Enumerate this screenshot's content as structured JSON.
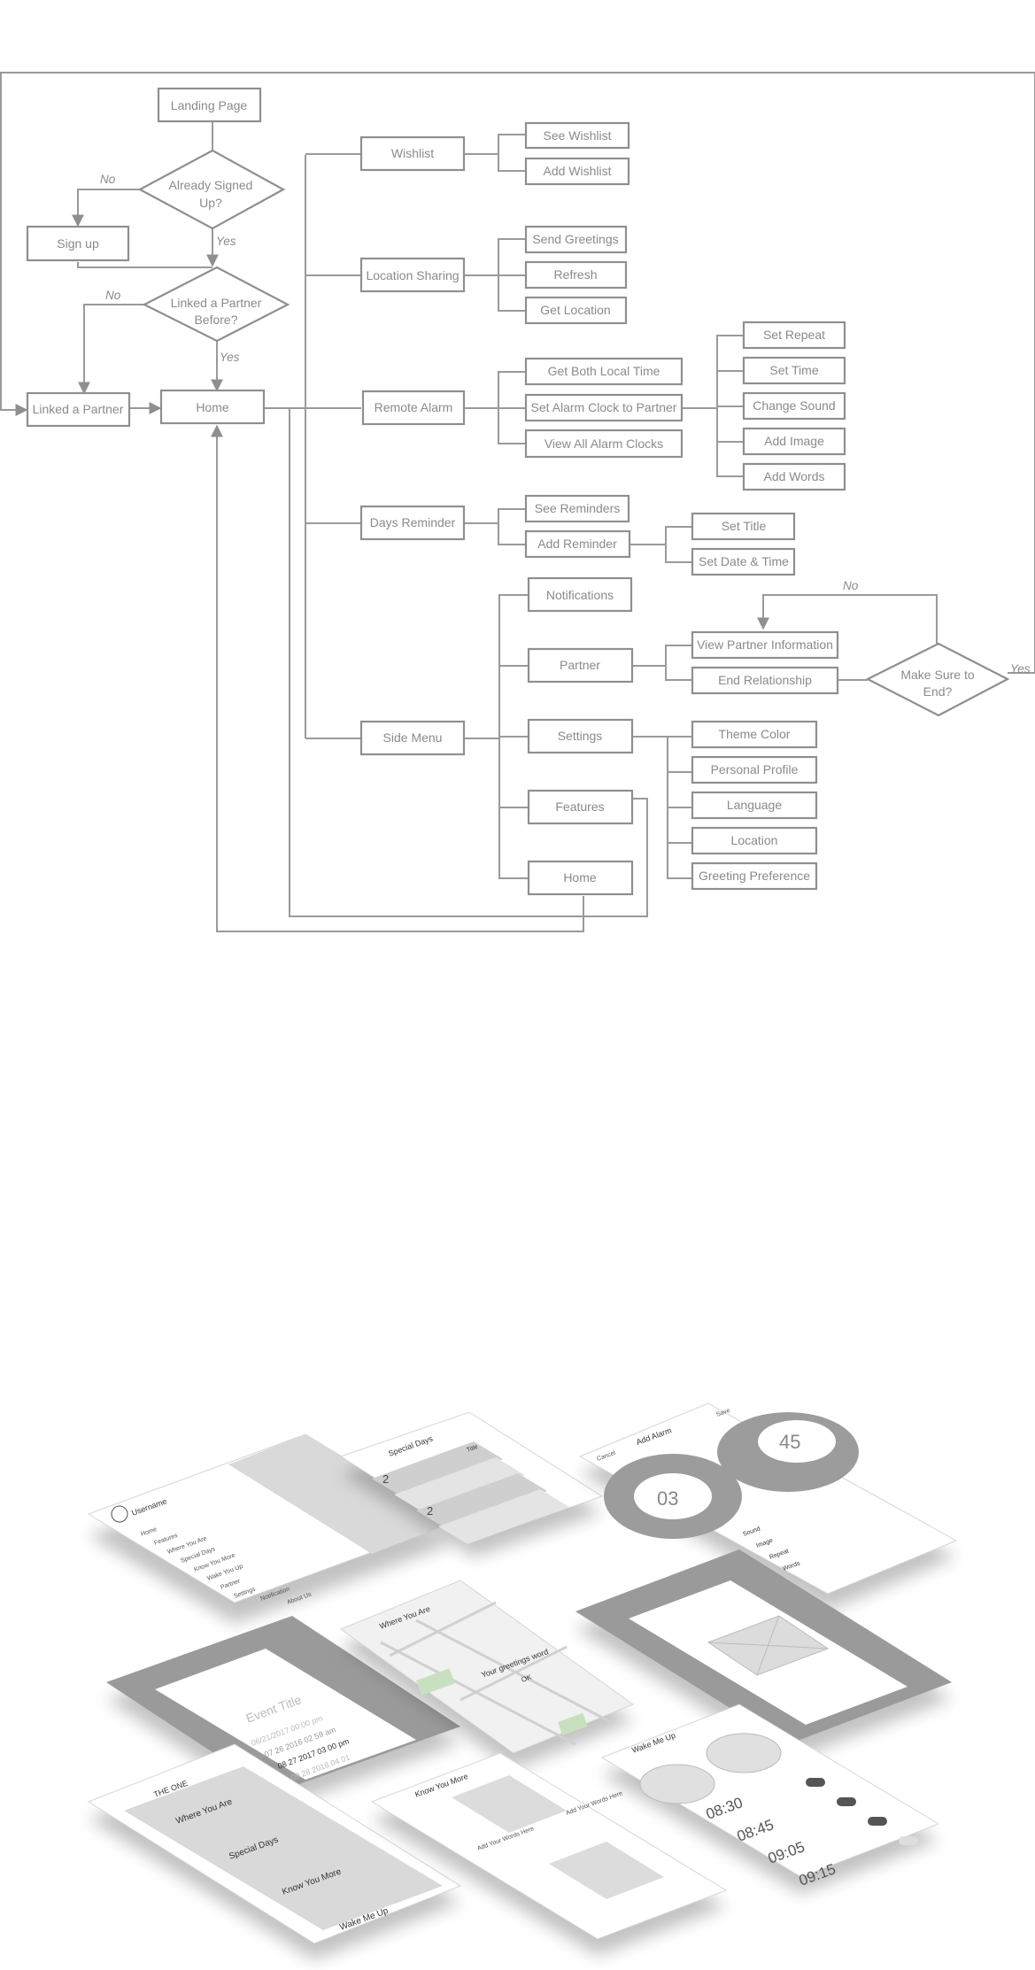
{
  "flowchart": {
    "nodes": {
      "landing_page": "Landing Page",
      "already_signed_up_l1": "Already Signed",
      "already_signed_up_l2": "Up?",
      "sign_up": "Sign up",
      "linked_before_l1": "Linked a Partner",
      "linked_before_l2": "Before?",
      "linked_a_partner": "Linked a Partner",
      "home": "Home",
      "wishlist": "Wishlist",
      "see_wishlist": "See Wishlist",
      "add_wishlist": "Add Wishlist",
      "location_sharing": "Location Sharing",
      "send_greetings": "Send Greetings",
      "refresh": "Refresh",
      "get_location": "Get Location",
      "remote_alarm": "Remote Alarm",
      "get_both_local_time": "Get Both Local Time",
      "set_alarm_clock": "Set Alarm Clock to Partner",
      "view_all_alarm_clocks": "View All Alarm Clocks",
      "set_repeat": "Set Repeat",
      "set_time": "Set Time",
      "change_sound": "Change Sound",
      "add_image": "Add Image",
      "add_words": "Add Words",
      "days_reminder": "Days Reminder",
      "see_reminders": "See Reminders",
      "add_reminder": "Add Reminder",
      "set_title": "Set Title",
      "set_date_time": "Set Date & Time",
      "side_menu": "Side Menu",
      "notifications": "Notifications",
      "partner": "Partner",
      "settings": "Settings",
      "features": "Features",
      "home2": "Home",
      "view_partner_info": "View Partner Information",
      "end_relationship": "End Relationship",
      "make_sure_l1": "Make Sure to",
      "make_sure_l2": "End?",
      "theme_color": "Theme Color",
      "personal_profile": "Personal Profile",
      "language": "Language",
      "location": "Location",
      "greeting_preference": "Greeting Preference"
    },
    "edge_labels": {
      "no_signed": "No",
      "yes_signed": "Yes",
      "no_linked": "No",
      "yes_linked": "Yes",
      "no_end": "No",
      "yes_end": "Yes"
    }
  },
  "mockups": {
    "menu_username": "Username",
    "menu_items": [
      "Home",
      "Features",
      "Where You Are",
      "Special Days",
      "Know You More",
      "Wake You Up",
      "Partner",
      "Settings",
      "Notification",
      "About Us"
    ],
    "special_days_title": "Special Days",
    "special_days_count": "2",
    "special_days_row_title": "Title",
    "alarm_cancel": "Cancel",
    "alarm_title": "Add Alarm",
    "alarm_save": "Save",
    "alarm_hour": "03",
    "alarm_minute": "45",
    "alarm_rows": [
      "Sound",
      "Image",
      "Repeat",
      "Words"
    ],
    "where_you_are_title": "Where You Are",
    "greeting_text": "Your greetings word",
    "greeting_ok": "OK",
    "event_title": "Event Title",
    "event_dates": [
      "06/21/2017 00:00 pm",
      "07 26 2016 02 59 am",
      "08 27 2017 03 00 pm",
      "09 28 2018 04 01"
    ],
    "home_title": "THE ONE",
    "home_tiles": [
      "Where You Are",
      "Special Days",
      "Know You More",
      "Wake Me Up"
    ],
    "know_title": "Know You More",
    "know_add": "Add Your Words Here",
    "wake_title": "Wake Me Up",
    "wake_times": [
      "08:30",
      "08:45",
      "09:05",
      "09:15"
    ]
  }
}
